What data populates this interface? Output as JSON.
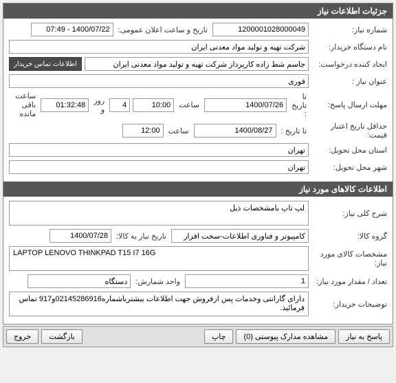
{
  "section1": {
    "title": "جزئیات اطلاعات نیاز",
    "need_no_label": "شماره نیاز:",
    "need_no": "1200001028000049",
    "announce_label": "تاریخ و ساعت اعلان عمومی:",
    "announce_val": "1400/07/22 - 07:49",
    "buyer_label": "نام دستگاه خریدار:",
    "buyer_val": "شرکت تهیه و تولید مواد معدنی ایران",
    "creator_label": "ایجاد کننده درخواست:",
    "creator_val": "جاسم شط زاده کارپرداز شرکت تهیه و تولید مواد معدنی ایران",
    "contact_btn": "اطلاعات تماس خریدار",
    "title_label": "عنوان نیاز :",
    "title_val": "فوری",
    "deadline_label": "مهلت ارسال پاسخ:",
    "to_date_label": "تا تاریخ :",
    "deadline_date": "1400/07/26",
    "time_label": "ساعت",
    "deadline_time": "10:00",
    "days_val": "4",
    "days_label": "روز و",
    "countdown": "01:32:48",
    "remain_label": "ساعت باقی مانده",
    "price_valid_label": "حداقل تاریخ اعتبار قیمت:",
    "price_valid_date": "1400/08/27",
    "price_valid_time": "12:00",
    "province_label": "استان محل تحویل:",
    "province_val": "تهران",
    "city_label": "شهر محل تحویل:",
    "city_val": "تهران"
  },
  "section2": {
    "title": "اطلاعات کالاهای مورد نیاز",
    "desc_label": "شرح کلی نیاز:",
    "desc_val": "لپ تاپ بامشخصات ذیل",
    "group_label": "گروه کالا:",
    "group_val": "کامپیوتر و فناوری اطلاعات-سخت افزار",
    "need_date_label": "تاریخ نیاز به کالا:",
    "need_date_val": "1400/07/28",
    "spec_label": "مشخصات کالای مورد نیاز:",
    "spec_val": "LAPTOP LENOVO THINKPAD T15 I7 16G",
    "qty_label": "تعداد / مقدار مورد نیاز:",
    "qty_val": "1",
    "unit_label": "واحد شمارش:",
    "unit_val": "دستگاه",
    "notes_label": "توضیحات خریدار:",
    "notes_val": "دارای گارانتی وخدمات پس ازفروش جهت اطلاعات بیشترباشماره02145286916و917 تماس فرمائید."
  },
  "footer": {
    "reply": "پاسخ به نیاز",
    "attach": "مشاهده مدارک پیوستی (0)",
    "print": "چاپ",
    "back": "بازگشت",
    "exit": "خروج"
  }
}
